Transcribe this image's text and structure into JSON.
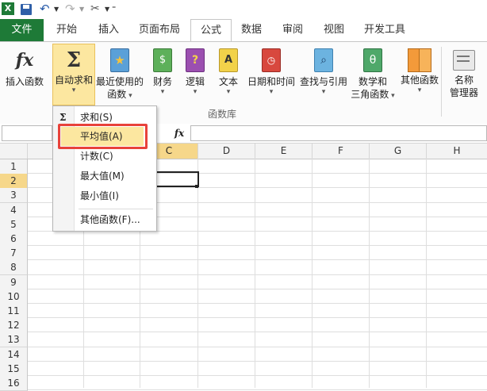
{
  "qat": {
    "undo_icon": "undo-icon",
    "redo_icon": "redo-icon"
  },
  "tabs": [
    {
      "label": "文件"
    },
    {
      "label": "开始"
    },
    {
      "label": "插入"
    },
    {
      "label": "页面布局"
    },
    {
      "label": "公式"
    },
    {
      "label": "数据"
    },
    {
      "label": "审阅"
    },
    {
      "label": "视图"
    },
    {
      "label": "开发工具"
    }
  ],
  "ribbon": {
    "insert_function": "插入函数",
    "autosum": "自动求和",
    "recent_line1": "最近使用的",
    "recent_line2": "函数",
    "financial": "财务",
    "logical": "逻辑",
    "text": "文本",
    "datetime": "日期和时间",
    "lookup": "查找与引用",
    "math_line1": "数学和",
    "math_line2": "三角函数",
    "more": "其他函数",
    "name_line1": "名称",
    "name_line2": "管理器",
    "group_caption": "函数库"
  },
  "formula_bar": {
    "fx": "fx"
  },
  "columns": [
    "C",
    "D",
    "E",
    "F",
    "G",
    "H"
  ],
  "rows": [
    "1",
    "2",
    "3",
    "4",
    "5",
    "6",
    "7",
    "8",
    "9",
    "10",
    "11",
    "12",
    "13",
    "14",
    "15",
    "16"
  ],
  "menu": {
    "sum": "求和(S)",
    "average": "平均值(A)",
    "count": "计数(C)",
    "max": "最大值(M)",
    "min": "最小值(I)",
    "more": "其他函数(F)..."
  },
  "colors": {
    "file_tab": "#1e7a37",
    "highlight_box": "#e8423a",
    "autosum_active": "#fce7a0"
  }
}
